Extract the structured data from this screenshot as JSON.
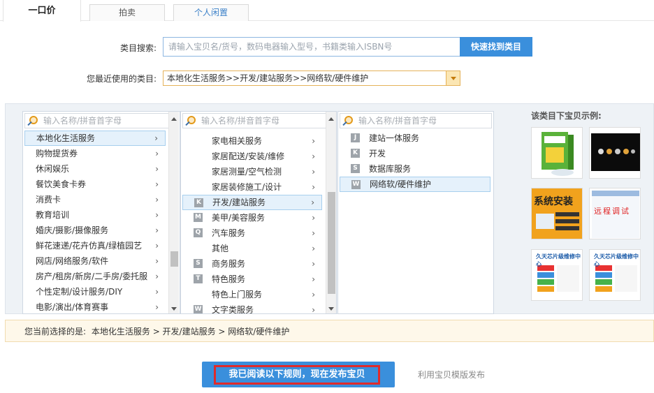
{
  "tabs": [
    {
      "label": "一口价"
    },
    {
      "label": "拍卖"
    },
    {
      "label": "个人闲置"
    }
  ],
  "search": {
    "label": "类目搜索:",
    "placeholder": "请输入宝贝名/货号，数码电器输入型号，书籍类输入ISBN号",
    "button": "快速找到类目"
  },
  "recent": {
    "label": "您最近使用的类目:",
    "value": "本地化生活服务>>开发/建站服务>>网络软/硬件维护"
  },
  "columns": [
    {
      "filter_placeholder": "输入名称/拼音首字母",
      "items": [
        {
          "label": "本地化生活服务"
        },
        {
          "label": "购物提货券"
        },
        {
          "label": "休闲娱乐"
        },
        {
          "label": "餐饮美食卡券"
        },
        {
          "label": "消费卡"
        },
        {
          "label": "教育培训"
        },
        {
          "label": "婚庆/摄影/摄像服务"
        },
        {
          "label": "鲜花速递/花卉仿真/绿植园艺"
        },
        {
          "label": "网店/网络服务/软件"
        },
        {
          "label": "房产/租房/新房/二手房/委托服"
        },
        {
          "label": "个性定制/设计服务/DIY"
        },
        {
          "label": "电影/演出/体育赛事"
        }
      ]
    },
    {
      "filter_placeholder": "输入名称/拼音首字母",
      "items": [
        {
          "letter": "",
          "label": "家电相关服务"
        },
        {
          "letter": "",
          "label": "家居配送/安装/维修"
        },
        {
          "letter": "",
          "label": "家居测量/空气检测"
        },
        {
          "letter": "",
          "label": "家居装修施工/设计"
        },
        {
          "letter": "K",
          "label": "开发/建站服务"
        },
        {
          "letter": "M",
          "label": "美甲/美容服务"
        },
        {
          "letter": "Q",
          "label": "汽车服务"
        },
        {
          "letter": "",
          "label": "其他"
        },
        {
          "letter": "S",
          "label": "商务服务"
        },
        {
          "letter": "T",
          "label": "特色服务"
        },
        {
          "letter": "",
          "label": "特色上门服务"
        },
        {
          "letter": "W",
          "label": "文字类服务"
        }
      ]
    },
    {
      "filter_placeholder": "输入名称/拼音首字母",
      "items": [
        {
          "letter": "J",
          "label": "建站一体服务"
        },
        {
          "letter": "K",
          "label": "开发"
        },
        {
          "letter": "S",
          "label": "数据库服务"
        },
        {
          "letter": "W",
          "label": "网络软/硬件维护"
        }
      ]
    }
  ],
  "examples": {
    "title": "该类目下宝贝示例:",
    "img3_text": "系统安装",
    "img4_text": "远程调试",
    "img5_text": "久天芯片级维修中心",
    "img6_text": "久天芯片级维修中心"
  },
  "status": {
    "prefix": "您当前选择的是:",
    "path": "本地化生活服务 > 开发/建站服务 > 网络软/硬件维护"
  },
  "buttons": {
    "publish": "我已阅读以下规则，现在发布宝贝",
    "template": "利用宝贝模版发布"
  },
  "colors": {
    "primary": "#3a8fdc",
    "highlight_border": "#e02b2b",
    "selected_bg": "#e5f1fb"
  }
}
